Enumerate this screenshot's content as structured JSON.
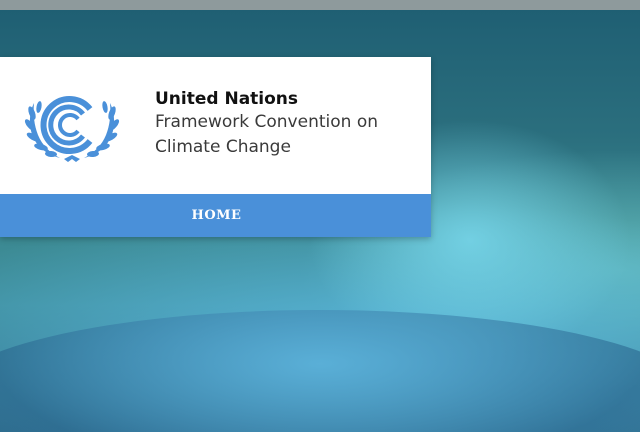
{
  "header": {
    "org": {
      "name": "United Nations",
      "line2": "Framework Convention on",
      "line3": "Climate Change"
    },
    "logo": {
      "icon": "unfccc-logo-icon",
      "color": "#4a90d9"
    }
  },
  "nav": {
    "home_label": "HOME",
    "bar_color": "#4a90d9"
  }
}
